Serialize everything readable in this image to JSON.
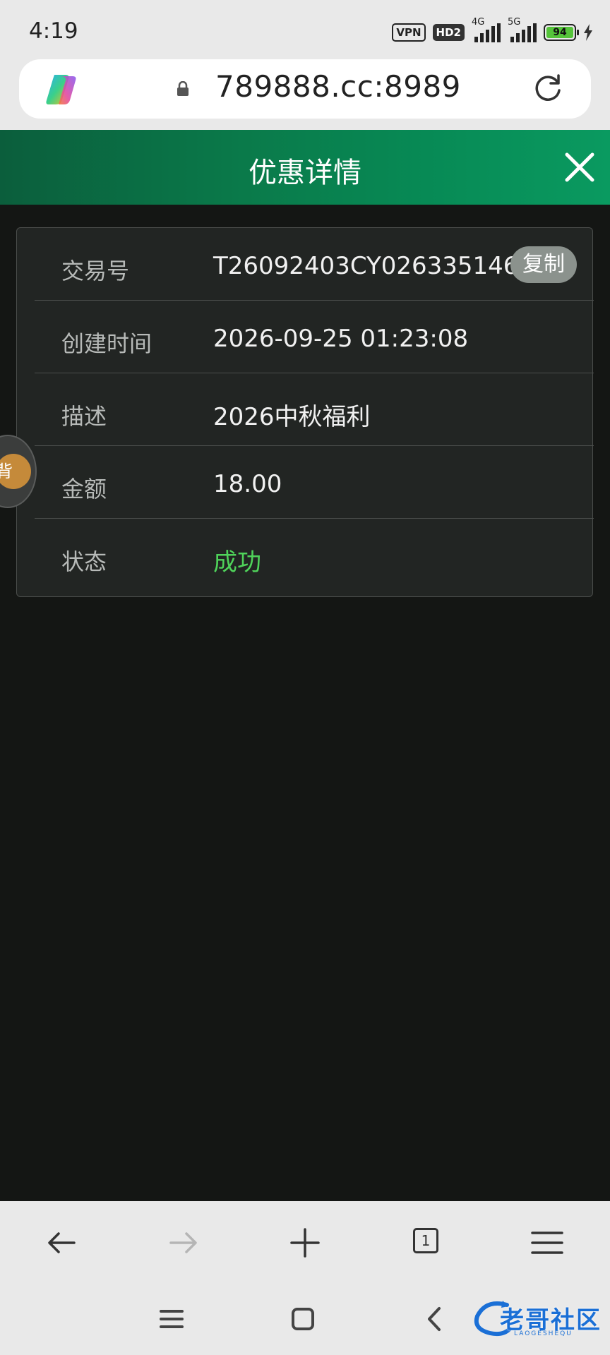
{
  "status_bar": {
    "time": "4:19",
    "vpn_label": "VPN",
    "hd_label": "HD2",
    "signal1_label": "4G",
    "signal2_label": "5G",
    "battery": "94"
  },
  "browser": {
    "url": "789888.cc:8989"
  },
  "header": {
    "title": "优惠详情"
  },
  "details": {
    "rows": [
      {
        "label": "交易号",
        "value": "T26092403CY026335146"
      },
      {
        "label": "创建时间",
        "value": "2026-09-25 01:23:08"
      },
      {
        "label": "描述",
        "value": "2026中秋福利"
      },
      {
        "label": "金额",
        "value": "18.00"
      },
      {
        "label": "状态",
        "value": "成功"
      }
    ],
    "copy_label": "复制",
    "status_color": "#4fd35a"
  },
  "bubble": {
    "glyph": "背"
  },
  "toolbar": {
    "tab_count": "1"
  },
  "watermark": {
    "text": "老哥社区",
    "sub": "LAOGESHEQU"
  },
  "colors": {
    "header_start": "#0b5e3c",
    "header_end": "#0a9a60",
    "page_bg": "#141614",
    "card_bg": "#222523"
  }
}
